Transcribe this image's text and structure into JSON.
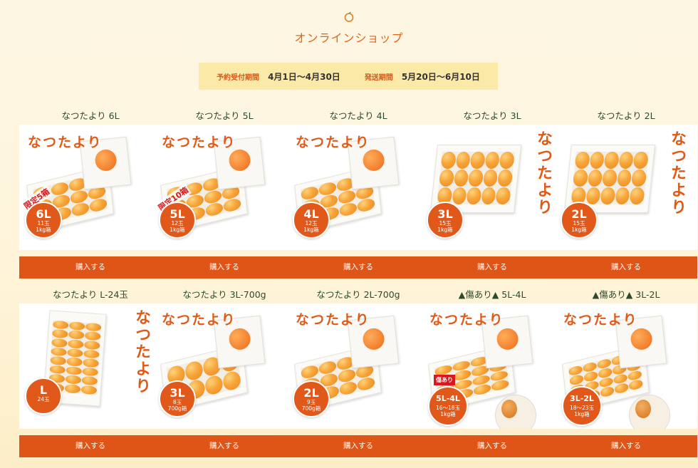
{
  "header": {
    "title": "オンラインショップ",
    "logo_icon": "orange-fruit-icon"
  },
  "banner": {
    "reservation_label": "予約受付期間",
    "reservation_value": "4月1日〜4月30日",
    "shipping_label": "発送期間",
    "shipping_value": "5月20日〜6月10日"
  },
  "products": [
    {
      "name": "なつたより 6L",
      "button": "購入する",
      "badge_size": "6L",
      "badge_count": "11玉",
      "badge_weight": "1kg箱",
      "tag": "限定5箱",
      "brand": "なつたより",
      "fruit_count": 11
    },
    {
      "name": "なつたより 5L",
      "button": "購入する",
      "badge_size": "5L",
      "badge_count": "12玉",
      "badge_weight": "1kg箱",
      "tag": "限定10箱",
      "brand": "なつたより",
      "fruit_count": 12
    },
    {
      "name": "なつたより 4L",
      "button": "購入する",
      "badge_size": "4L",
      "badge_count": "12玉",
      "badge_weight": "1kg箱",
      "brand": "なつたより",
      "fruit_count": 12
    },
    {
      "name": "なつたより 3L",
      "button": "購入する",
      "badge_size": "3L",
      "badge_count": "15玉",
      "badge_weight": "1kg箱",
      "brand": "なつたより",
      "fruit_count": 15
    },
    {
      "name": "なつたより 2L",
      "button": "購入する",
      "badge_size": "2L",
      "badge_count": "15玉",
      "badge_weight": "1kg箱",
      "brand": "なつたより",
      "fruit_count": 15
    },
    {
      "name": "なつたより L-24玉",
      "button": "購入する",
      "badge_size": "L",
      "badge_count": "24玉",
      "brand": "なつたより",
      "fruit_count": 24
    },
    {
      "name": "なつたより 3L-700g",
      "button": "購入する",
      "badge_size": "3L",
      "badge_count": "8玉",
      "badge_weight": "700g箱",
      "brand": "なつたより",
      "fruit_count": 8
    },
    {
      "name": "なつたより 2L-700g",
      "button": "購入する",
      "badge_size": "2L",
      "badge_count": "9玉",
      "badge_weight": "700g箱",
      "brand": "なつたより",
      "fruit_count": 9
    },
    {
      "name": "▲傷あり▲ 5L-4L",
      "button": "購入する",
      "badge_size": "5L-4L",
      "badge_count": "16〜18玉",
      "badge_weight": "1kg箱",
      "tag": "傷あり",
      "brand": "なつたより",
      "fruit_count": 16
    },
    {
      "name": "▲傷あり▲ 3L-2L",
      "button": "購入する",
      "badge_size": "3L-2L",
      "badge_count": "18〜23玉",
      "badge_weight": "1kg箱",
      "brand": "なつたより",
      "fruit_count": 20
    }
  ],
  "colors": {
    "accent": "#df5417",
    "title": "#e0651c",
    "product_name": "#2b4a2e",
    "banner_bg": "#fbe9a8"
  }
}
